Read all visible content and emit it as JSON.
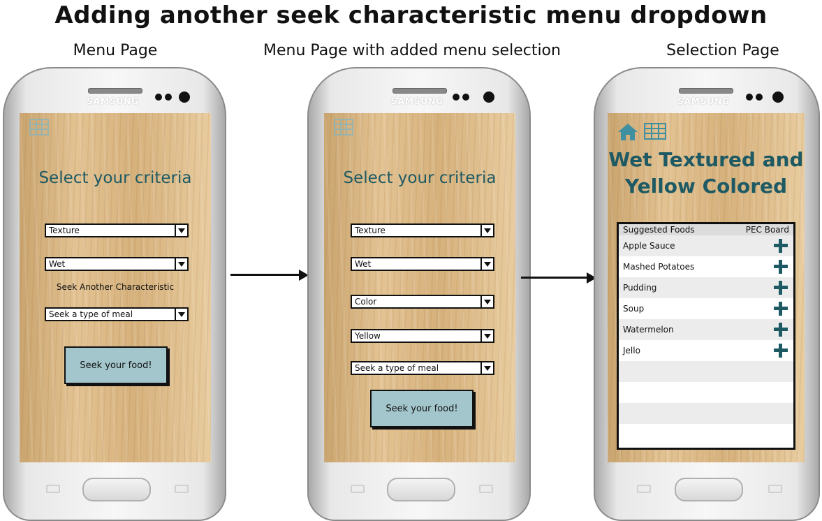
{
  "title": "Adding another seek characteristic menu dropdown",
  "columns": {
    "left": "Menu Page",
    "middle": "Menu Page with added menu selection",
    "right": "Selection Page"
  },
  "phone_brand": "SAMSUNG",
  "menu_page": {
    "heading": "Select your criteria",
    "dropdown1": "Texture",
    "dropdown2": "Wet",
    "seek_another": "Seek Another Characteristic",
    "meal_dropdown": "Seek a type of meal",
    "seek_button": "Seek your food!"
  },
  "menu_page_added": {
    "heading": "Select your criteria",
    "dropdown1": "Texture",
    "dropdown2": "Wet",
    "dropdown3": "Color",
    "dropdown4": "Yellow",
    "meal_dropdown": "Seek a type of meal",
    "seek_button": "Seek your food!"
  },
  "selection_page": {
    "heading": "Wet Textured and Yellow Colored",
    "table_header": {
      "left": "Suggested Foods",
      "right": "PEC Board"
    },
    "foods": [
      "Apple Sauce",
      "Mashed Potatoes",
      "Pudding",
      "Soup",
      "Watermelon",
      "Jello"
    ]
  },
  "colors": {
    "heading": "#1e5a64",
    "button": "#a3c6cc",
    "wood": "#e3c393"
  },
  "icons": [
    "grid-icon",
    "home-icon",
    "plus-icon",
    "dropdown-arrow-icon"
  ]
}
